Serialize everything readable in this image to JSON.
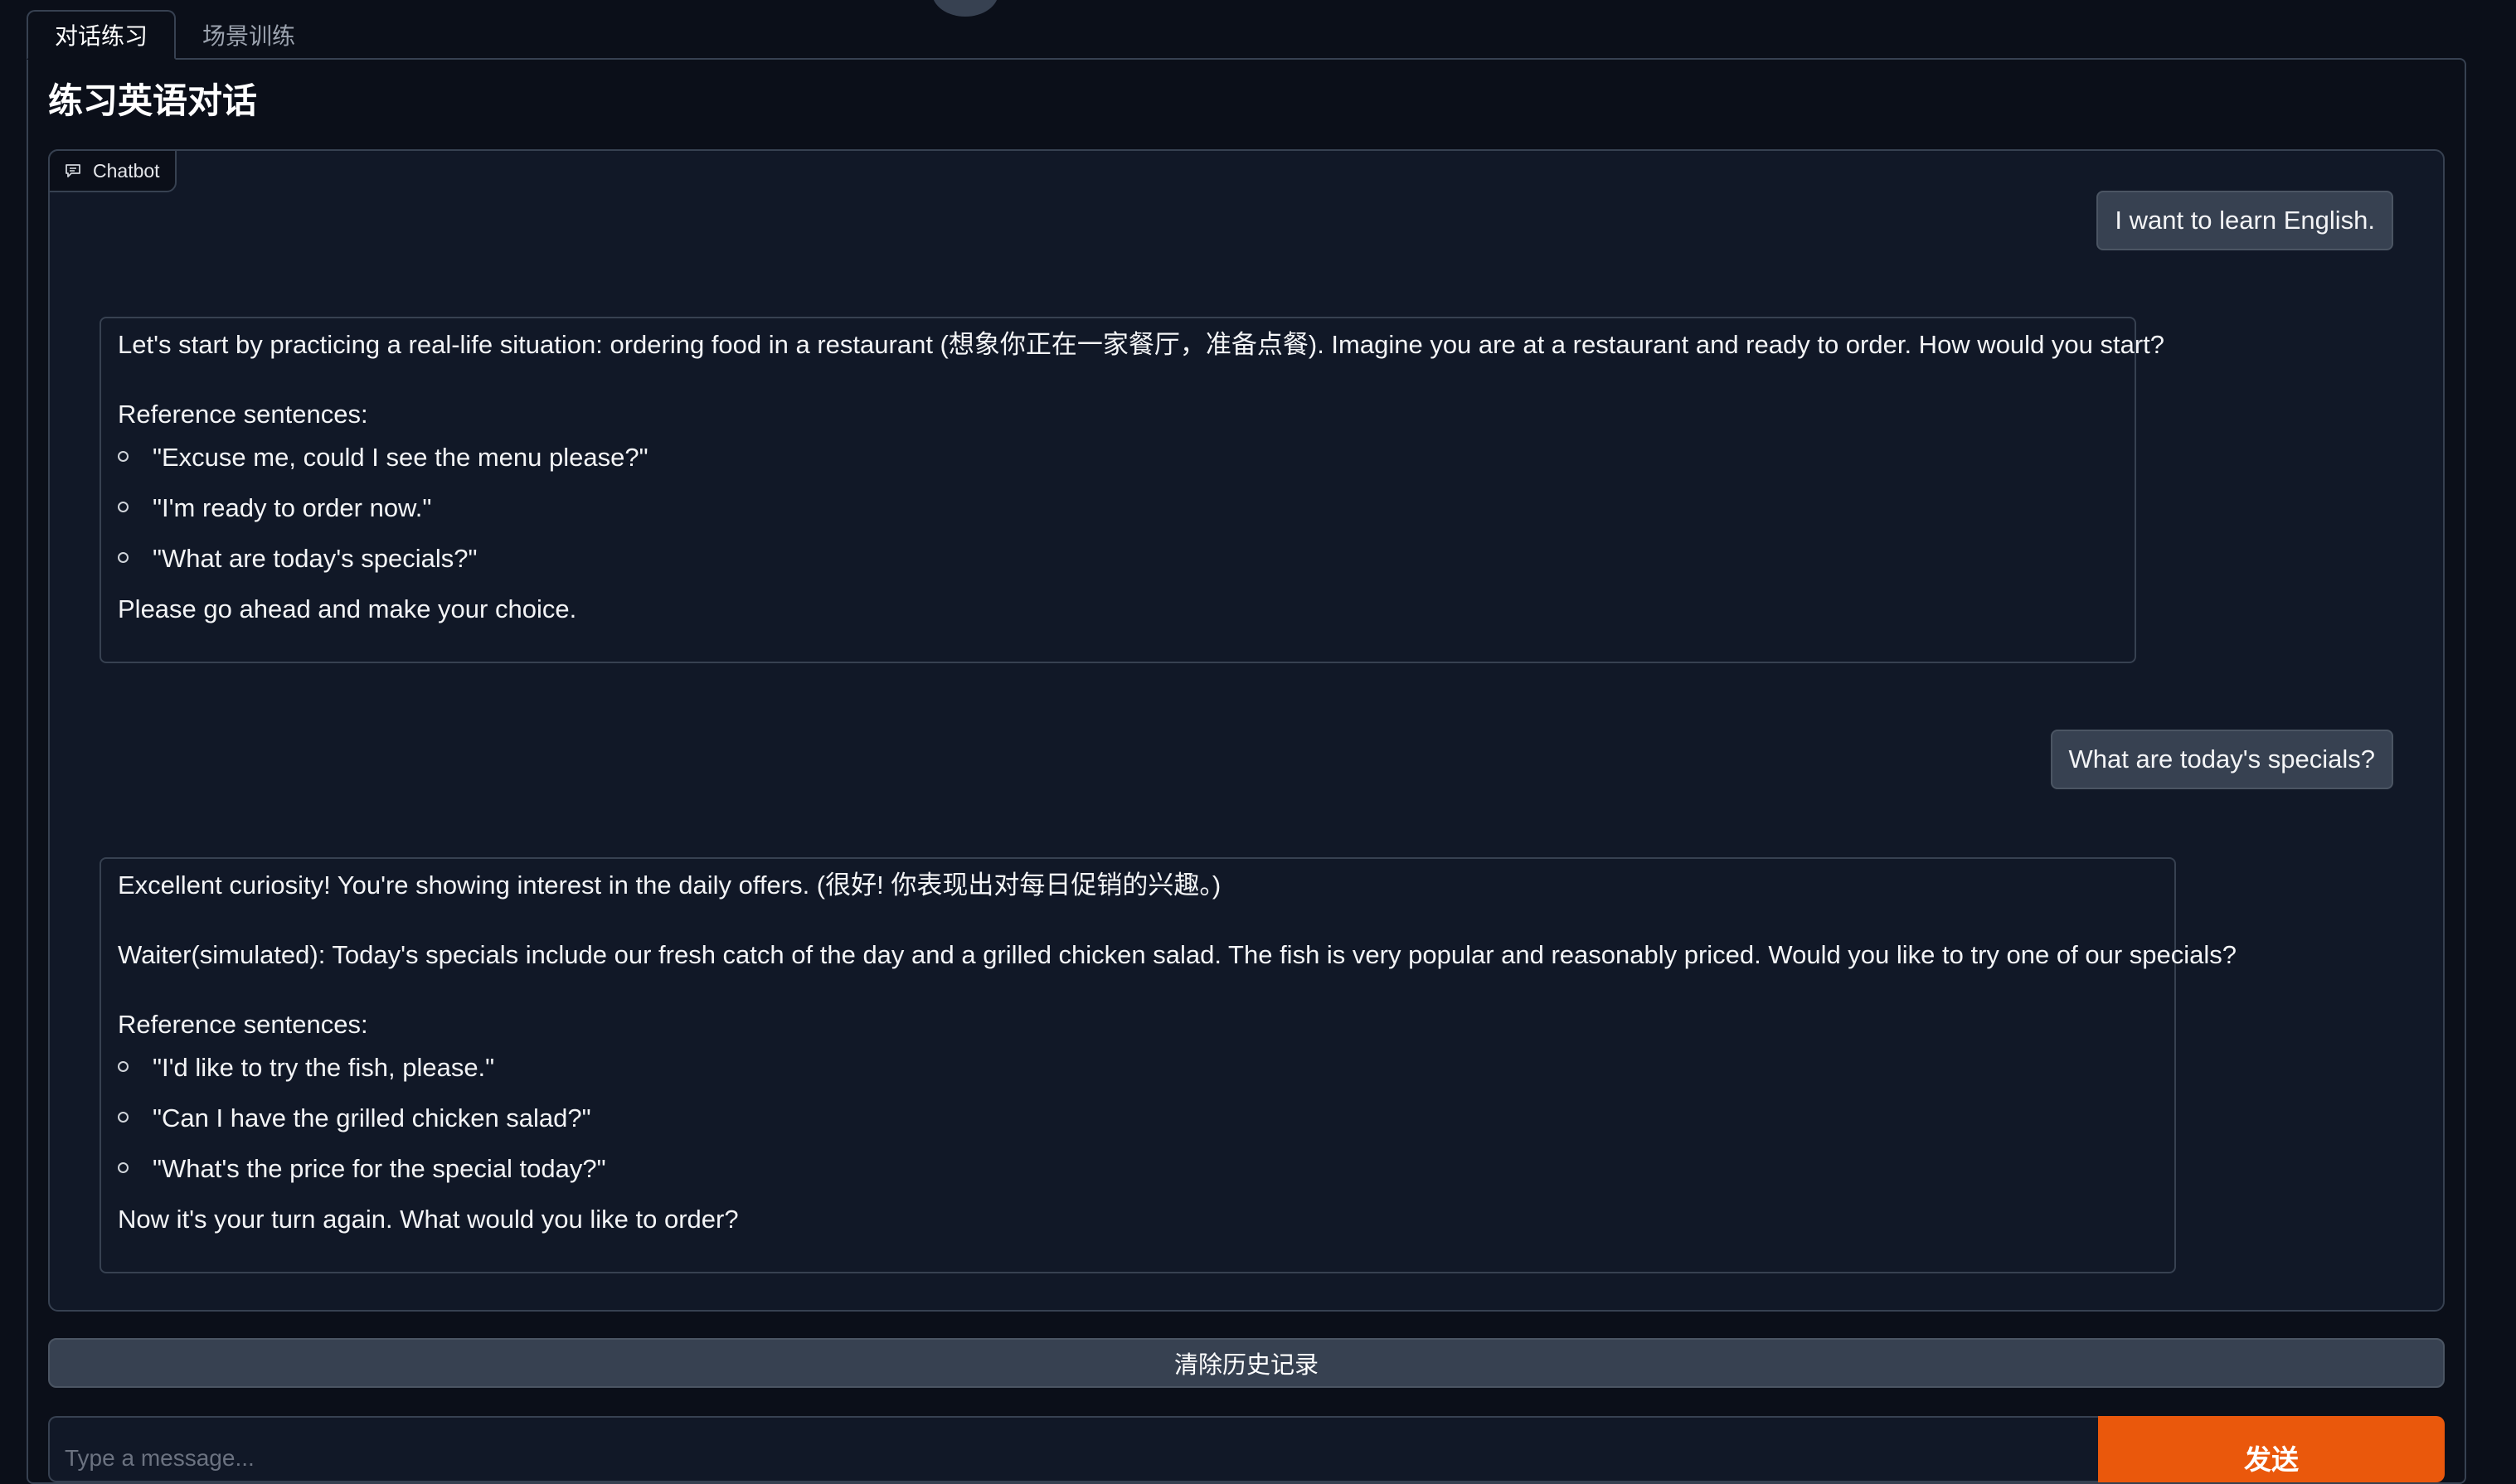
{
  "tabs": [
    {
      "label": "对话练习",
      "active": true
    },
    {
      "label": "场景训练",
      "active": false
    }
  ],
  "page_title": "练习英语对话",
  "chatbot": {
    "label": "Chatbot",
    "icon": "chat-bubble-icon",
    "messages": [
      {
        "role": "user",
        "text": "I want to learn English."
      },
      {
        "role": "bot",
        "paragraphs": [
          "Let's start by practicing a real-life situation: ordering food in a restaurant (想象你正在一家餐厅，准备点餐). Imagine you are at a restaurant and ready to order. How would you start?",
          "Reference sentences:"
        ],
        "list": [
          "\"Excuse me, could I see the menu please?\"",
          "\"I'm ready to order now.\"",
          "\"What are today's specials?\""
        ],
        "closing": "Please go ahead and make your choice."
      },
      {
        "role": "user",
        "text": "What are today's specials?"
      },
      {
        "role": "bot",
        "paragraphs": [
          "Excellent curiosity! You're showing interest in the daily offers. (很好! 你表现出对每日促销的兴趣。)",
          "Waiter(simulated): Today's specials include our fresh catch of the day and a grilled chicken salad. The fish is very popular and reasonably priced. Would you like to try one of our specials?",
          "Reference sentences:"
        ],
        "list": [
          "\"I'd like to try the fish, please.\"",
          "\"Can I have the grilled chicken salad?\"",
          "\"What's the price for the special today?\""
        ],
        "closing": "Now it's your turn again. What would you like to order?"
      }
    ]
  },
  "clear_button": {
    "label": "清除历史记录"
  },
  "input": {
    "placeholder": "Type a message...",
    "value": ""
  },
  "send_button": {
    "label": "发送"
  },
  "colors": {
    "background": "#0b0f19",
    "panel": "#111827",
    "border": "#374151",
    "accent": "#ea580c"
  }
}
